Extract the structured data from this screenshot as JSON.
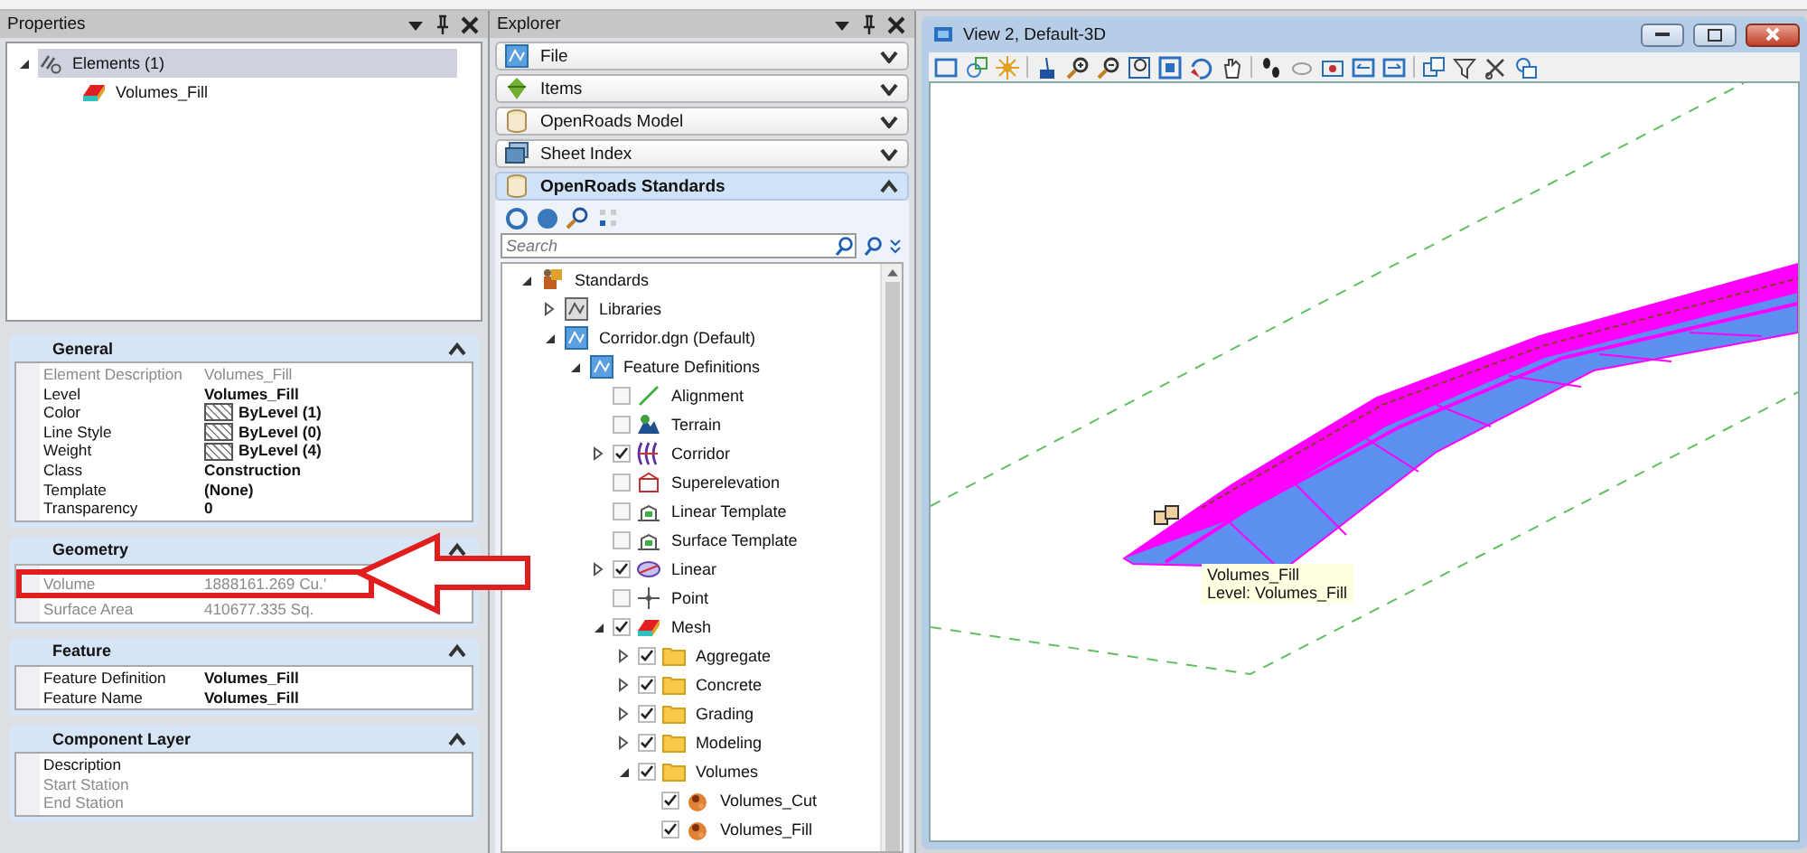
{
  "properties": {
    "title": "Properties",
    "tree": [
      {
        "label": "Elements (1)",
        "kind": "group",
        "selected": true,
        "expanded": true,
        "children": [
          {
            "label": "Volumes_Fill",
            "kind": "mesh",
            "selected": false
          }
        ]
      }
    ],
    "sections": [
      {
        "title": "General",
        "expanded": true,
        "rows": [
          {
            "label": "Element Description",
            "value": "Volumes_Fill",
            "disabled": true,
            "kind": "text"
          },
          {
            "label": "Level",
            "value": "Volumes_Fill",
            "disabled": false,
            "kind": "text"
          },
          {
            "label": "Color",
            "value": "ByLevel (1)",
            "disabled": false,
            "kind": "swatch"
          },
          {
            "label": "Line Style",
            "value": "ByLevel (0)",
            "disabled": false,
            "kind": "swatch"
          },
          {
            "label": "Weight",
            "value": "ByLevel (4)",
            "disabled": false,
            "kind": "swatch"
          },
          {
            "label": "Class",
            "value": "Construction",
            "disabled": false,
            "kind": "text"
          },
          {
            "label": "Template",
            "value": "(None)",
            "disabled": false,
            "kind": "text"
          },
          {
            "label": "Transparency",
            "value": "0",
            "disabled": false,
            "kind": "text"
          }
        ]
      },
      {
        "title": "Geometry",
        "expanded": true,
        "rows": [
          {
            "label": "Volume",
            "value": "1888161.269 Cu.'",
            "disabled": true,
            "kind": "text",
            "highlighted": true
          },
          {
            "label": "Surface Area",
            "value": "410677.335 Sq.",
            "disabled": true,
            "kind": "text"
          }
        ]
      },
      {
        "title": "Feature",
        "expanded": true,
        "rows": [
          {
            "label": "Feature Definition",
            "value": "Volumes_Fill",
            "disabled": false,
            "kind": "text"
          },
          {
            "label": "Feature Name",
            "value": "Volumes_Fill",
            "disabled": false,
            "kind": "text"
          }
        ]
      },
      {
        "title": "Component Layer",
        "expanded": true,
        "rows": [
          {
            "label": "Description",
            "disabled": false,
            "kind": "text"
          },
          {
            "label": "Start Station",
            "disabled": true,
            "kind": "text"
          },
          {
            "label": "End Station",
            "disabled": true,
            "kind": "text"
          }
        ]
      }
    ]
  },
  "explorer": {
    "title": "Explorer",
    "sections": [
      {
        "title": "File",
        "kind": "file",
        "expanded": false
      },
      {
        "title": "Items",
        "kind": "items",
        "expanded": false
      },
      {
        "title": "OpenRoads Model",
        "kind": "model",
        "expanded": false
      },
      {
        "title": "Sheet Index",
        "kind": "sheets",
        "expanded": false
      },
      {
        "title": "OpenRoads Standards",
        "kind": "model",
        "expanded": true,
        "search": {
          "placeholder": "Search"
        },
        "tree": [
          {
            "label": "Standards",
            "kind": "standards",
            "expanded": true,
            "children": [
              {
                "label": "Libraries",
                "kind": "library",
                "expanded": false
              },
              {
                "label": "Corridor.dgn (Default)",
                "kind": "dgn",
                "expanded": true,
                "children": [
                  {
                    "label": "Feature Definitions",
                    "kind": "dgn",
                    "expanded": true,
                    "children": [
                      {
                        "label": "Alignment",
                        "kind": "alignment",
                        "checked": false
                      },
                      {
                        "label": "Terrain",
                        "kind": "terrain",
                        "checked": false
                      },
                      {
                        "label": "Corridor",
                        "kind": "corridor",
                        "checked": true,
                        "expanded": false
                      },
                      {
                        "label": "Superelevation",
                        "kind": "superelevation",
                        "checked": false
                      },
                      {
                        "label": "Linear Template",
                        "kind": "template",
                        "checked": false
                      },
                      {
                        "label": "Surface Template",
                        "kind": "template",
                        "checked": false
                      },
                      {
                        "label": "Linear",
                        "kind": "linear",
                        "checked": true,
                        "expanded": false
                      },
                      {
                        "label": "Point",
                        "kind": "point",
                        "checked": false
                      },
                      {
                        "label": "Mesh",
                        "kind": "mesh",
                        "checked": true,
                        "expanded": true,
                        "children": [
                          {
                            "label": "Aggregate",
                            "kind": "folder",
                            "checked": true,
                            "expanded": false
                          },
                          {
                            "label": "Concrete",
                            "kind": "folder",
                            "checked": true,
                            "expanded": false
                          },
                          {
                            "label": "Grading",
                            "kind": "folder",
                            "checked": true,
                            "expanded": false
                          },
                          {
                            "label": "Modeling",
                            "kind": "folder",
                            "checked": true,
                            "expanded": false
                          },
                          {
                            "label": "Volumes",
                            "kind": "folder",
                            "checked": true,
                            "expanded": true,
                            "children": [
                              {
                                "label": "Volumes_Cut",
                                "kind": "volume",
                                "checked": true
                              },
                              {
                                "label": "Volumes_Fill",
                                "kind": "volume",
                                "checked": true
                              }
                            ]
                          }
                        ]
                      }
                    ]
                  }
                ]
              }
            ]
          }
        ]
      }
    ]
  },
  "view": {
    "title": "View 2, Default-3D",
    "tooltip": [
      "Volumes_Fill",
      "Level: Volumes_Fill"
    ]
  }
}
